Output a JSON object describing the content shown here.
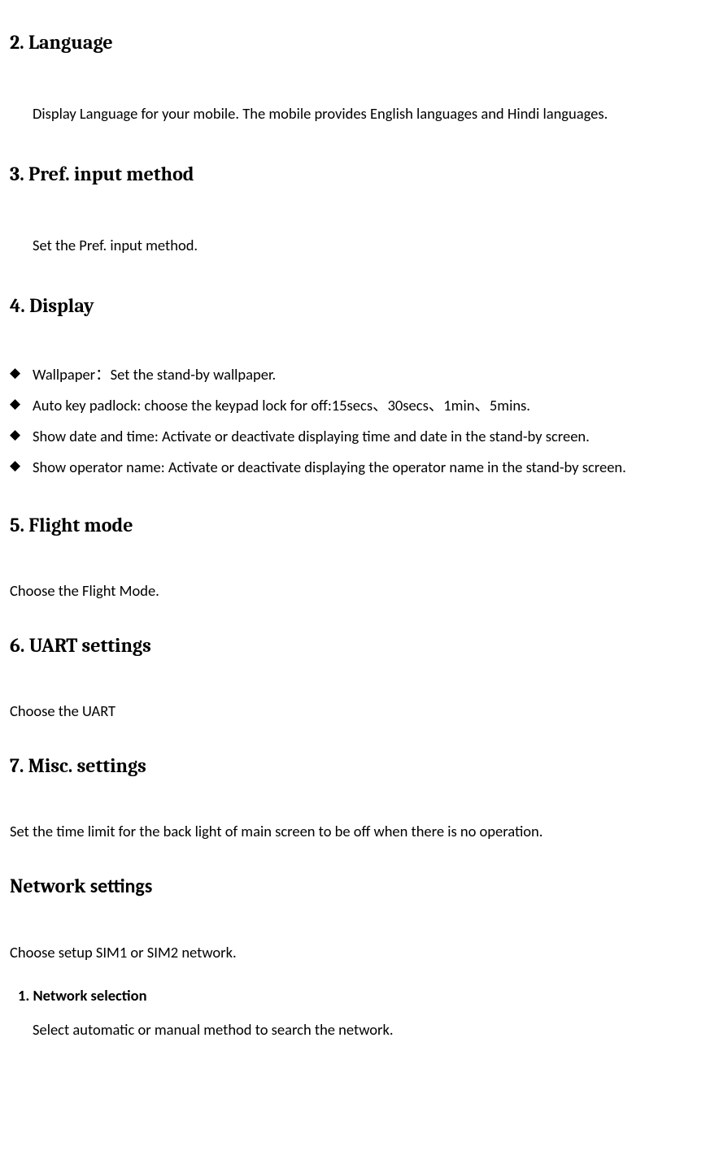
{
  "sections": {
    "s2": {
      "heading": "2. Language",
      "body": "Display Language for your mobile. The mobile provides English languages and Hindi languages."
    },
    "s3": {
      "heading": "3. Pref. input method",
      "body": "Set the Pref. input method."
    },
    "s4": {
      "heading": "4. Display",
      "bullets": [
        "Wallpaper：Set the stand-by wallpaper.",
        "Auto key padlock: choose the keypad lock for off:15secs、30secs、1min、5mins.",
        "Show date and time: Activate or deactivate displaying time and date in the stand-by screen.",
        "Show operator name: Activate or deactivate displaying the operator name in the stand-by screen."
      ]
    },
    "s5": {
      "heading": "5. Flight mode",
      "body": "Choose the Flight Mode."
    },
    "s6": {
      "heading": "6. UART settings",
      "body": "Choose the UART"
    },
    "s7": {
      "heading": "7. Misc. settings",
      "body": "Set the time limit for the back light of main screen to be off when there is no operation."
    },
    "network": {
      "heading_part1": "Network ",
      "heading_part2": "settings",
      "body": "Choose setup SIM1 or SIM2 network.",
      "sub1_heading": "1.  Network selection",
      "sub1_body": "Select automatic or manual method to search the network."
    }
  }
}
